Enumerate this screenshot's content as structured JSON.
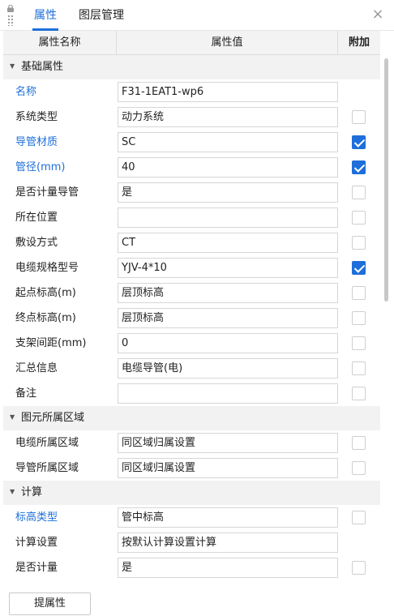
{
  "tabs": [
    {
      "label": "属性",
      "active": true
    },
    {
      "label": "图层管理",
      "active": false
    }
  ],
  "close_symbol": "×",
  "header": {
    "name_col": "属性名称",
    "value_col": "属性值",
    "extra_col": "附加"
  },
  "group_toggle_symbol": "▼",
  "groups": [
    {
      "title": "基础属性",
      "rows": [
        {
          "label": "名称",
          "value": "F31-1EAT1-wp6",
          "highlight": true,
          "checkbox": "none"
        },
        {
          "label": "系统类型",
          "value": "动力系统",
          "highlight": false,
          "checkbox": "off"
        },
        {
          "label": "导管材质",
          "value": "SC",
          "highlight": true,
          "checkbox": "on"
        },
        {
          "label": "管径(mm)",
          "value": "40",
          "highlight": true,
          "checkbox": "on"
        },
        {
          "label": "是否计量导管",
          "value": "是",
          "highlight": false,
          "checkbox": "off"
        },
        {
          "label": "所在位置",
          "value": "",
          "highlight": false,
          "checkbox": "off"
        },
        {
          "label": "敷设方式",
          "value": "CT",
          "highlight": false,
          "checkbox": "off"
        },
        {
          "label": "电缆规格型号",
          "value": "YJV-4*10",
          "highlight": false,
          "checkbox": "on"
        },
        {
          "label": "起点标高(m)",
          "value": "层顶标高",
          "highlight": false,
          "checkbox": "off"
        },
        {
          "label": "终点标高(m)",
          "value": "层顶标高",
          "highlight": false,
          "checkbox": "off"
        },
        {
          "label": "支架间距(mm)",
          "value": "0",
          "highlight": false,
          "checkbox": "off"
        },
        {
          "label": "汇总信息",
          "value": "电缆导管(电)",
          "highlight": false,
          "checkbox": "off"
        },
        {
          "label": "备注",
          "value": "",
          "highlight": false,
          "checkbox": "off"
        }
      ]
    },
    {
      "title": "图元所属区域",
      "rows": [
        {
          "label": "电缆所属区域",
          "value": "同区域归属设置",
          "highlight": false,
          "checkbox": "off"
        },
        {
          "label": "导管所属区域",
          "value": "同区域归属设置",
          "highlight": false,
          "checkbox": "off"
        }
      ]
    },
    {
      "title": "计算",
      "rows": [
        {
          "label": "标高类型",
          "value": "管中标高",
          "highlight": true,
          "checkbox": "off"
        },
        {
          "label": "计算设置",
          "value": "按默认计算设置计算",
          "highlight": false,
          "checkbox": "none"
        },
        {
          "label": "是否计量",
          "value": "是",
          "highlight": false,
          "checkbox": "off"
        }
      ]
    }
  ],
  "footer": {
    "button_label": "提属性"
  },
  "colors": {
    "accent": "#1e6fd9",
    "group_bg": "#f2f2f2",
    "header_bg": "#f3f3f3"
  }
}
